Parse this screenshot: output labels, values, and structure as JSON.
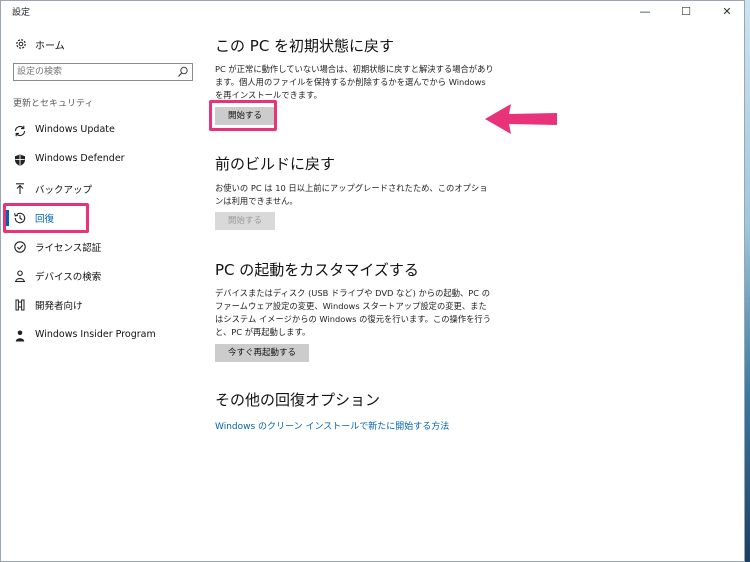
{
  "window": {
    "title": "設定",
    "controls": {
      "minimize": "—",
      "maximize": "☐",
      "close": "✕"
    }
  },
  "sidebar": {
    "home_label": "ホーム",
    "search_placeholder": "設定の検索",
    "section_label": "更新とセキュリティ",
    "items": [
      {
        "label": "Windows Update",
        "icon": "sync-icon"
      },
      {
        "label": "Windows Defender",
        "icon": "shield-icon"
      },
      {
        "label": "バックアップ",
        "icon": "upload-arrow-icon"
      },
      {
        "label": "回復",
        "icon": "history-icon",
        "active": true
      },
      {
        "label": "ライセンス認証",
        "icon": "check-circle-icon"
      },
      {
        "label": "デバイスの検索",
        "icon": "person-location-icon"
      },
      {
        "label": "開発者向け",
        "icon": "developer-icon"
      },
      {
        "label": "Windows Insider Program",
        "icon": "insider-icon"
      }
    ]
  },
  "content": {
    "reset": {
      "title": "この PC を初期状態に戻す",
      "description": "PC が正常に動作していない場合は、初期状態に戻すと解決する場合があります。個人用のファイルを保持するか削除するかを選んでから Windows を再インストールできます。",
      "button": "開始する"
    },
    "rollback": {
      "title": "前のビルドに戻す",
      "description": "お使いの PC は 10 日以上前にアップグレードされたため、このオプションは利用できません。",
      "button": "開始する"
    },
    "advanced": {
      "title": "PC の起動をカスタマイズする",
      "description": "デバイスまたはディスク (USB ドライブや DVD など) からの起動、PC のファームウェア設定の変更、Windows スタートアップ設定の変更、またはシステム イメージからの Windows の復元を行います。この操作を行うと、PC が再起動します。",
      "button": "今すぐ再起動する"
    },
    "more": {
      "title": "その他の回復オプション",
      "link": "Windows のクリーン インストールで新たに開始する方法"
    }
  },
  "colors": {
    "accent": "#0063b1",
    "highlight": "#e8327a",
    "button": "#cccccc"
  }
}
